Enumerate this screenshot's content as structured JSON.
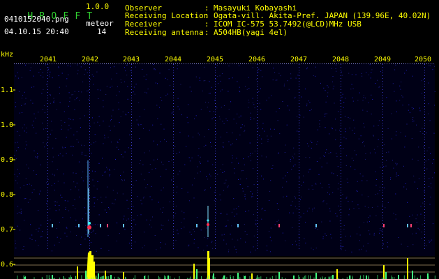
{
  "app": {
    "title_letters": [
      "H",
      "R",
      "O",
      "F",
      "F",
      "T"
    ],
    "version": "1.0.0"
  },
  "file": {
    "name": "0410152040.png",
    "datetime": "04.10.15 20:40",
    "meteor_label": "meteor",
    "meteor_count": "14"
  },
  "info": {
    "rows": [
      {
        "label": "Observer",
        "value": "Masayuki Kobayashi"
      },
      {
        "label": "Receiving Location",
        "value": "Ogata-vill. Akita-Pref. JAPAN (139.96E, 40.02N)"
      },
      {
        "label": "Receiver",
        "value": "ICOM IC-575 53.7492(@LCD)MHz USB"
      },
      {
        "label": "Receiving antenna",
        "value": "A504HB(yagi 4el)"
      }
    ],
    "separator": ":"
  },
  "axis": {
    "unit": "kHz",
    "y_ticks": [
      "1.1",
      "1.0",
      "0.9",
      "0.8",
      "0.7",
      "0.6"
    ],
    "x_ticks": [
      "2041",
      "2042",
      "2043",
      "2044",
      "2045",
      "2046",
      "2047",
      "2048",
      "2049",
      "2050"
    ]
  },
  "colors": {
    "background": "#000000",
    "spectrum_bg": "#000016",
    "noise": "#1a1aa0",
    "text_yellow": "#ffff00",
    "text_green": "#30d030",
    "echo_red": "#ff3050",
    "echo_cyan": "#40ffff",
    "bar_yellow": "#ffff00",
    "bar_green": "#40ff80"
  }
}
